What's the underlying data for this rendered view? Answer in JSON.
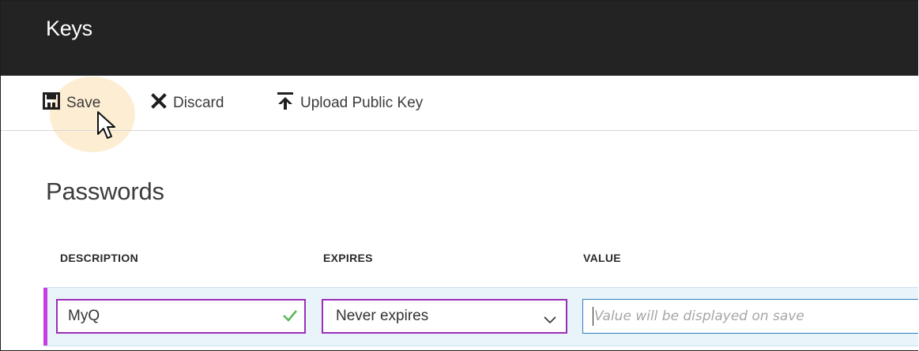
{
  "window": {
    "title": "Keys"
  },
  "toolbar": {
    "save_label": "Save",
    "discard_label": "Discard",
    "upload_label": "Upload Public Key"
  },
  "section": {
    "title": "Passwords"
  },
  "table": {
    "columns": [
      "DESCRIPTION",
      "EXPIRES",
      "VALUE"
    ],
    "row": {
      "description": "MyQ",
      "expires": "Never expires",
      "value_placeholder": "Value will be displayed on save"
    }
  },
  "icons": {
    "save": "save-icon",
    "discard": "close-icon",
    "upload": "upload-icon",
    "valid": "checkmark-icon",
    "dropdown": "chevron-down-icon",
    "cursor": "mouse-pointer-icon"
  },
  "colors": {
    "titlebar": "#232323",
    "accent_rail": "#c43ee0",
    "field_border": "#9a2fb8",
    "focused_border": "#2f7dc1",
    "valid_check": "#5cb85c",
    "row_background": "#e9f3fa",
    "click_highlight": "#fce8c4"
  }
}
